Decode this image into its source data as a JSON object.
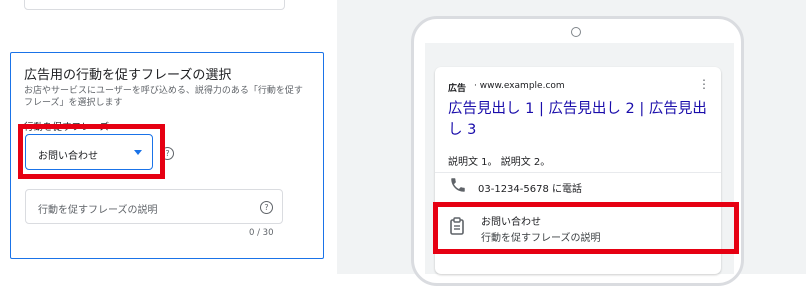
{
  "settings": {
    "section_title": "広告用の行動を促すフレーズの選択",
    "section_description": "お店やサービスにユーザーを呼び込める、説得力のある「行動を促すフレーズ」を選択します",
    "cta_field_label": "行動を促すフレーズ",
    "cta_selected": "お問い合わせ",
    "cta_description_placeholder": "行動を促すフレーズの説明",
    "char_counter": "0 / 30",
    "help_glyph": "?"
  },
  "preview": {
    "ad_badge": "広告",
    "display_url": "· www.example.com",
    "more_glyph": "⋮",
    "headline": "広告見出し 1 | 広告見出し 2 | 広告見出し 3",
    "description": "説明文 1。 説明文 2。",
    "call_extension": "03-1234-5678 に電話",
    "cta_title": "お問い合わせ",
    "cta_subtitle": "行動を促すフレーズの説明"
  },
  "icons": {
    "dropdown": "chevron-down-icon",
    "help": "help-icon",
    "phone": "phone-icon",
    "clipboard": "clipboard-icon",
    "more": "more-vert-icon"
  },
  "colors": {
    "accent": "#1a73e8",
    "headline_link": "#1a0dab",
    "highlight": "#e60012",
    "preview_background": "#f1f3f4"
  }
}
